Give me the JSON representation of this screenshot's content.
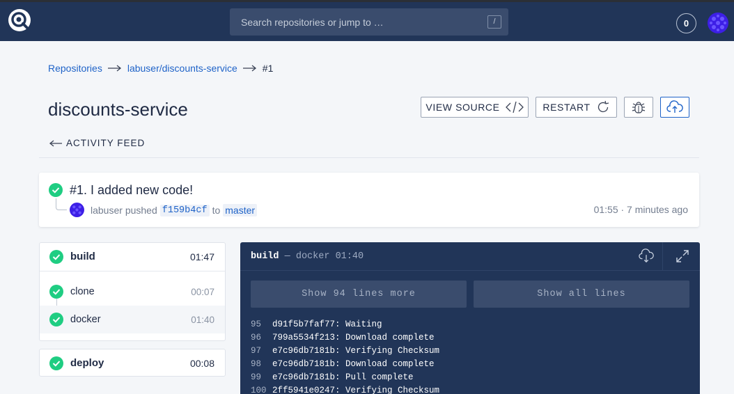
{
  "header": {
    "search_placeholder": "Search repositories or jump to …",
    "search_shortcut": "/",
    "notifications_count": "0"
  },
  "breadcrumb": {
    "root": "Repositories",
    "repo": "labuser/discounts-service",
    "build": "#1"
  },
  "repo_title": "discounts-service",
  "actions": {
    "view_source": "VIEW SOURCE",
    "restart": "RESTART"
  },
  "activity_feed_label": "ACTIVITY FEED",
  "build": {
    "title": "#1. I added new code!",
    "author": "labuser",
    "verb": "pushed",
    "commit": "f159b4cf",
    "to_word": "to",
    "branch": "master",
    "time": "01:55 · 7 minutes ago",
    "status": "success"
  },
  "stages": [
    {
      "name": "build",
      "duration": "01:47",
      "steps": [
        {
          "name": "clone",
          "duration": "00:07"
        },
        {
          "name": "docker",
          "duration": "01:40"
        }
      ]
    },
    {
      "name": "deploy",
      "duration": "00:08"
    }
  ],
  "log": {
    "stage": "build",
    "separator": "—",
    "step": "docker",
    "duration": "01:40",
    "show_more_label": "Show 94 lines more",
    "show_all_label": "Show all lines",
    "lines": [
      {
        "n": "95",
        "text": "d91f5b7faf77: Waiting"
      },
      {
        "n": "96",
        "text": "799a5534f213: Download complete"
      },
      {
        "n": "97",
        "text": "e7c96db7181b: Verifying Checksum"
      },
      {
        "n": "98",
        "text": "e7c96db7181b: Download complete"
      },
      {
        "n": "99",
        "text": "e7c96db7181b: Pull complete"
      },
      {
        "n": "100",
        "text": "2ff5941e0247: Verifying Checksum"
      }
    ]
  },
  "colors": {
    "topbar": "#213558",
    "accent": "#1f63c8",
    "success": "#1fcd82",
    "log_bg": "#213558"
  },
  "icons": {
    "logo": "drone-logo-icon",
    "avatar": "identicon-avatar",
    "source": "code-icon",
    "restart": "refresh-icon",
    "debug": "bug-icon",
    "deploy": "cloud-upload-icon",
    "download": "cloud-download-icon",
    "expand": "expand-icon",
    "back": "arrow-left-icon",
    "status": "check-icon"
  }
}
